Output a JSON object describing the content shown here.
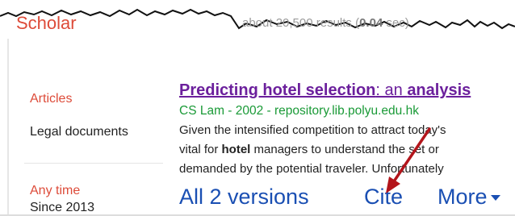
{
  "header": {
    "logo_text": "Scholar",
    "results_prefix": "about 20,500 results (",
    "results_time": "0.04",
    "results_suffix": " sec)"
  },
  "sidebar": {
    "items": [
      {
        "label": "Articles"
      },
      {
        "label": "Legal documents"
      }
    ],
    "time_filter": {
      "label": "Any time",
      "option": "Since 2013"
    }
  },
  "result": {
    "title_bold": "Predicting hotel selection",
    "title_rest": ": an ",
    "title_bold2": "analysis",
    "meta": "CS Lam - 2002 - repository.lib.polyu.edu.hk",
    "snippet_line1": "Given the intensified competition to attract today's",
    "snippet_line2_pre": "vital for ",
    "snippet_line2_bold": "hotel",
    "snippet_line2_post": " managers to understand the set or",
    "snippet_line3": "demanded by the potential traveler. Unfortunately",
    "actions": {
      "versions": "All 2 versions",
      "cite": "Cite",
      "more": "More"
    }
  },
  "colors": {
    "logo": "#dd4b39",
    "title_visited": "#6b1f9c",
    "meta_green": "#1a9a37",
    "link_blue": "#1a4fb3",
    "arrow": "#b3151b"
  }
}
